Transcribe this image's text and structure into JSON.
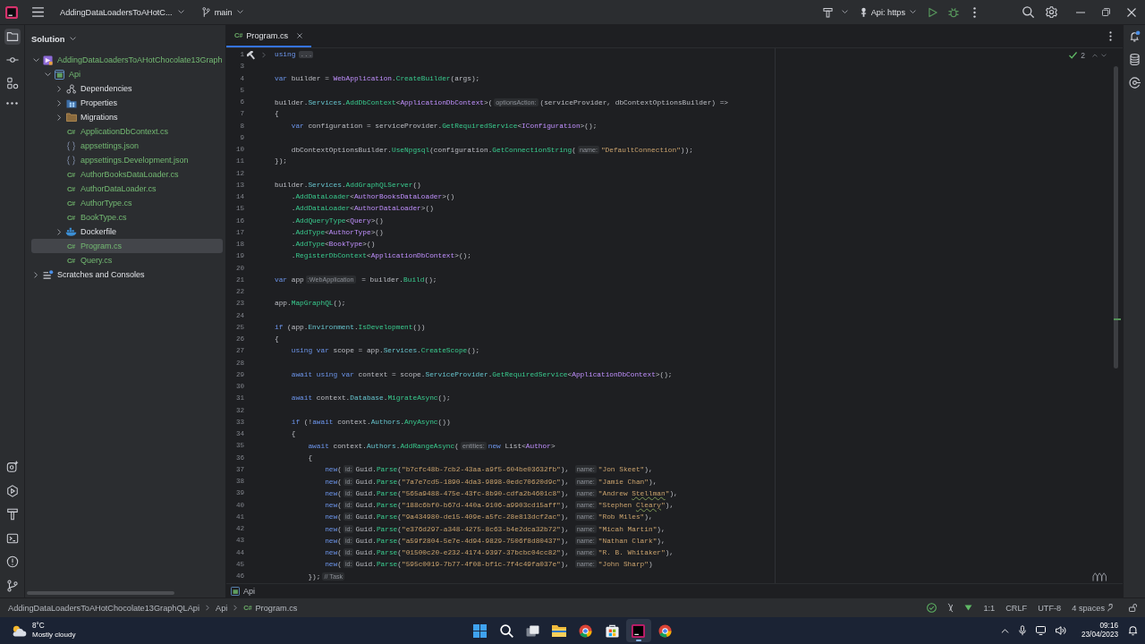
{
  "title_bar": {
    "project": "AddingDataLoadersToAHotC...",
    "branch": "main",
    "run_config": "Api: https"
  },
  "tool_strip": {
    "top": [
      {
        "kind": "project",
        "selected": true
      },
      {
        "kind": "commit",
        "selected": false
      },
      {
        "kind": "structure",
        "selected": false
      }
    ],
    "bottom": [
      {
        "kind": "services",
        "selected": false
      },
      {
        "kind": "run",
        "selected": false
      },
      {
        "kind": "build",
        "selected": false
      },
      {
        "kind": "terminal",
        "selected": false
      },
      {
        "kind": "problems",
        "selected": false
      },
      {
        "kind": "git",
        "selected": false
      }
    ]
  },
  "project_panel": {
    "title": "Solution",
    "tree": [
      {
        "label": "AddingDataLoadersToAHotChocolate13Graph",
        "kind": "solution",
        "vcs_added": true,
        "expanded": true,
        "selected": false,
        "children": [
          {
            "label": "Api",
            "kind": "project",
            "vcs_added": true,
            "expanded": true,
            "selected": false,
            "children": [
              {
                "label": "Dependencies",
                "kind": "dependencies",
                "vcs_added": false,
                "expanded": false,
                "selected": false
              },
              {
                "label": "Properties",
                "kind": "properties",
                "vcs_added": false,
                "expanded": false,
                "selected": false
              },
              {
                "label": "Migrations",
                "kind": "folder",
                "vcs_added": false,
                "expanded": false,
                "selected": false
              },
              {
                "label": "ApplicationDbContext.cs",
                "kind": "csharp",
                "icon_text": "C#",
                "vcs_added": true,
                "selected": false
              },
              {
                "label": "appsettings.json",
                "kind": "json",
                "vcs_added": true,
                "selected": false
              },
              {
                "label": "appsettings.Development.json",
                "kind": "json",
                "vcs_added": true,
                "selected": false
              },
              {
                "label": "AuthorBooksDataLoader.cs",
                "kind": "csharp",
                "icon_text": "C#",
                "vcs_added": true,
                "selected": false
              },
              {
                "label": "AuthorDataLoader.cs",
                "kind": "csharp",
                "icon_text": "C#",
                "vcs_added": true,
                "selected": false
              },
              {
                "label": "AuthorType.cs",
                "kind": "csharp",
                "icon_text": "C#",
                "vcs_added": true,
                "selected": false
              },
              {
                "label": "BookType.cs",
                "kind": "csharp",
                "icon_text": "C#",
                "vcs_added": true,
                "selected": false
              },
              {
                "label": "Dockerfile",
                "kind": "docker",
                "vcs_added": false,
                "expanded": false,
                "selected": false
              },
              {
                "label": "Program.cs",
                "kind": "csharp",
                "icon_text": "C#",
                "vcs_added": true,
                "selected": true
              },
              {
                "label": "Query.cs",
                "kind": "csharp",
                "icon_text": "C#",
                "vcs_added": true,
                "selected": false
              }
            ]
          }
        ]
      },
      {
        "label": "Scratches and Consoles",
        "kind": "scratches",
        "vcs_added": false,
        "expanded": false,
        "selected": false
      }
    ]
  },
  "editor": {
    "tabs": [
      {
        "label": "Program.cs",
        "icon_text": "C#",
        "selected": true
      }
    ],
    "inspection_count": "2",
    "lines": [
      {
        "number": "1",
        "runnable": true,
        "tokens": [
          {
            "kind": "keyword",
            "text": "using"
          },
          {
            "kind": "folded",
            "text": "..."
          }
        ]
      },
      {
        "number": "3"
      },
      {
        "number": "4",
        "tokens": [
          {
            "kind": "keyword",
            "text": "var"
          },
          {
            "kind": "plain",
            "text": " builder = "
          },
          {
            "kind": "type",
            "text": "WebApplication"
          },
          {
            "kind": "plain",
            "text": "."
          },
          {
            "kind": "method",
            "text": "CreateBuilder"
          },
          {
            "kind": "plain",
            "text": "(args);"
          }
        ]
      },
      {
        "number": "5"
      },
      {
        "number": "6",
        "tokens": [
          {
            "kind": "plain",
            "text": "builder."
          },
          {
            "kind": "member",
            "text": "Services"
          },
          {
            "kind": "plain",
            "text": "."
          },
          {
            "kind": "method",
            "text": "AddDbContext"
          },
          {
            "kind": "plain",
            "text": "<"
          },
          {
            "kind": "type",
            "text": "ApplicationDbContext"
          },
          {
            "kind": "plain",
            "text": ">("
          },
          {
            "kind": "hint",
            "text": "optionsAction:"
          },
          {
            "kind": "plain",
            "text": "(serviceProvider, dbContextOptionsBuilder) =>"
          }
        ]
      },
      {
        "number": "7",
        "tokens": [
          {
            "kind": "plain",
            "text": "{"
          }
        ]
      },
      {
        "number": "8",
        "tokens": [
          {
            "kind": "keyword",
            "text": "    var"
          },
          {
            "kind": "plain",
            "text": " configuration = serviceProvider."
          },
          {
            "kind": "method",
            "text": "GetRequiredService"
          },
          {
            "kind": "plain",
            "text": "<"
          },
          {
            "kind": "type",
            "text": "IConfiguration"
          },
          {
            "kind": "plain",
            "text": ">();"
          }
        ]
      },
      {
        "number": "9"
      },
      {
        "number": "10",
        "tokens": [
          {
            "kind": "plain",
            "text": "    dbContextOptionsBuilder."
          },
          {
            "kind": "method",
            "text": "UseNpgsql"
          },
          {
            "kind": "plain",
            "text": "(configuration."
          },
          {
            "kind": "method",
            "text": "GetConnectionString"
          },
          {
            "kind": "plain",
            "text": "("
          },
          {
            "kind": "hint",
            "text": "name:"
          },
          {
            "kind": "string",
            "text": "\"DefaultConnection\""
          },
          {
            "kind": "plain",
            "text": "));"
          }
        ]
      },
      {
        "number": "11",
        "tokens": [
          {
            "kind": "plain",
            "text": "});"
          }
        ]
      },
      {
        "number": "12"
      },
      {
        "number": "13",
        "tokens": [
          {
            "kind": "plain",
            "text": "builder."
          },
          {
            "kind": "member",
            "text": "Services"
          },
          {
            "kind": "plain",
            "text": "."
          },
          {
            "kind": "method",
            "text": "AddGraphQLServer"
          },
          {
            "kind": "plain",
            "text": "()"
          }
        ]
      },
      {
        "number": "14",
        "tokens": [
          {
            "kind": "plain",
            "text": "    ."
          },
          {
            "kind": "method",
            "text": "AddDataLoader"
          },
          {
            "kind": "plain",
            "text": "<"
          },
          {
            "kind": "type",
            "text": "AuthorBooksDataLoader"
          },
          {
            "kind": "plain",
            "text": ">()"
          }
        ]
      },
      {
        "number": "15",
        "tokens": [
          {
            "kind": "plain",
            "text": "    ."
          },
          {
            "kind": "method",
            "text": "AddDataLoader"
          },
          {
            "kind": "plain",
            "text": "<"
          },
          {
            "kind": "type",
            "text": "AuthorDataLoader"
          },
          {
            "kind": "plain",
            "text": ">()"
          }
        ]
      },
      {
        "number": "16",
        "tokens": [
          {
            "kind": "plain",
            "text": "    ."
          },
          {
            "kind": "method",
            "text": "AddQueryType"
          },
          {
            "kind": "plain",
            "text": "<"
          },
          {
            "kind": "type",
            "text": "Query"
          },
          {
            "kind": "plain",
            "text": ">()"
          }
        ]
      },
      {
        "number": "17",
        "tokens": [
          {
            "kind": "plain",
            "text": "    ."
          },
          {
            "kind": "method",
            "text": "AddType"
          },
          {
            "kind": "plain",
            "text": "<"
          },
          {
            "kind": "type",
            "text": "AuthorType"
          },
          {
            "kind": "plain",
            "text": ">()"
          }
        ]
      },
      {
        "number": "18",
        "tokens": [
          {
            "kind": "plain",
            "text": "    ."
          },
          {
            "kind": "method",
            "text": "AddType"
          },
          {
            "kind": "plain",
            "text": "<"
          },
          {
            "kind": "type",
            "text": "BookType"
          },
          {
            "kind": "plain",
            "text": ">()"
          }
        ]
      },
      {
        "number": "19",
        "tokens": [
          {
            "kind": "plain",
            "text": "    ."
          },
          {
            "kind": "method",
            "text": "RegisterDbContext"
          },
          {
            "kind": "plain",
            "text": "<"
          },
          {
            "kind": "type",
            "text": "ApplicationDbContext"
          },
          {
            "kind": "plain",
            "text": ">();"
          }
        ]
      },
      {
        "number": "20"
      },
      {
        "number": "21",
        "tokens": [
          {
            "kind": "keyword",
            "text": "var"
          },
          {
            "kind": "plain",
            "text": " app"
          },
          {
            "kind": "hint",
            "text": ":WebApplication"
          },
          {
            "kind": "plain",
            "text": " = builder."
          },
          {
            "kind": "method",
            "text": "Build"
          },
          {
            "kind": "plain",
            "text": "();"
          }
        ]
      },
      {
        "number": "22"
      },
      {
        "number": "23",
        "tokens": [
          {
            "kind": "plain",
            "text": "app."
          },
          {
            "kind": "method",
            "text": "MapGraphQL"
          },
          {
            "kind": "plain",
            "text": "();"
          }
        ]
      },
      {
        "number": "24"
      },
      {
        "number": "25",
        "tokens": [
          {
            "kind": "keyword",
            "text": "if"
          },
          {
            "kind": "plain",
            "text": " (app."
          },
          {
            "kind": "member",
            "text": "Environment"
          },
          {
            "kind": "plain",
            "text": "."
          },
          {
            "kind": "method",
            "text": "IsDevelopment"
          },
          {
            "kind": "plain",
            "text": "())"
          }
        ]
      },
      {
        "number": "26",
        "tokens": [
          {
            "kind": "plain",
            "text": "{"
          }
        ]
      },
      {
        "number": "27",
        "tokens": [
          {
            "kind": "keyword",
            "text": "    using var"
          },
          {
            "kind": "plain",
            "text": " scope = app."
          },
          {
            "kind": "member",
            "text": "Services"
          },
          {
            "kind": "plain",
            "text": "."
          },
          {
            "kind": "method",
            "text": "CreateScope"
          },
          {
            "kind": "plain",
            "text": "();"
          }
        ]
      },
      {
        "number": "28"
      },
      {
        "number": "29",
        "tokens": [
          {
            "kind": "keyword",
            "text": "    await using var"
          },
          {
            "kind": "plain",
            "text": " context = scope."
          },
          {
            "kind": "member",
            "text": "ServiceProvider"
          },
          {
            "kind": "plain",
            "text": "."
          },
          {
            "kind": "method",
            "text": "GetRequiredService"
          },
          {
            "kind": "plain",
            "text": "<"
          },
          {
            "kind": "type",
            "text": "ApplicationDbContext"
          },
          {
            "kind": "plain",
            "text": ">();"
          }
        ]
      },
      {
        "number": "30"
      },
      {
        "number": "31",
        "tokens": [
          {
            "kind": "keyword",
            "text": "    await"
          },
          {
            "kind": "plain",
            "text": " context."
          },
          {
            "kind": "member",
            "text": "Database"
          },
          {
            "kind": "plain",
            "text": "."
          },
          {
            "kind": "method",
            "text": "MigrateAsync"
          },
          {
            "kind": "plain",
            "text": "();"
          }
        ]
      },
      {
        "number": "32"
      },
      {
        "number": "33",
        "tokens": [
          {
            "kind": "keyword",
            "text": "    if"
          },
          {
            "kind": "plain",
            "text": " (!"
          },
          {
            "kind": "keyword",
            "text": "await"
          },
          {
            "kind": "plain",
            "text": " context."
          },
          {
            "kind": "member",
            "text": "Authors"
          },
          {
            "kind": "plain",
            "text": "."
          },
          {
            "kind": "method",
            "text": "AnyAsync"
          },
          {
            "kind": "plain",
            "text": "())"
          }
        ]
      },
      {
        "number": "34",
        "tokens": [
          {
            "kind": "plain",
            "text": "    {"
          }
        ]
      },
      {
        "number": "35",
        "tokens": [
          {
            "kind": "keyword",
            "text": "        await"
          },
          {
            "kind": "plain",
            "text": " context."
          },
          {
            "kind": "member",
            "text": "Authors"
          },
          {
            "kind": "plain",
            "text": "."
          },
          {
            "kind": "method",
            "text": "AddRangeAsync"
          },
          {
            "kind": "plain",
            "text": "("
          },
          {
            "kind": "hint",
            "text": "entities:"
          },
          {
            "kind": "keyword",
            "text": "new"
          },
          {
            "kind": "plain",
            "text": " List<"
          },
          {
            "kind": "type",
            "text": "Author"
          },
          {
            "kind": "plain",
            "text": ">"
          }
        ]
      },
      {
        "number": "36",
        "tokens": [
          {
            "kind": "plain",
            "text": "        {"
          }
        ]
      },
      {
        "number": "37",
        "tokens": [
          {
            "kind": "keyword",
            "text": "            new"
          },
          {
            "kind": "plain",
            "text": "("
          },
          {
            "kind": "hint",
            "text": "id:"
          },
          {
            "kind": "plain",
            "text": "Guid."
          },
          {
            "kind": "method",
            "text": "Parse"
          },
          {
            "kind": "plain",
            "text": "("
          },
          {
            "kind": "string",
            "text": "\"b7cfc48b-7cb2-43aa-a9f5-604be03632fb\""
          },
          {
            "kind": "plain",
            "text": "), "
          },
          {
            "kind": "hint",
            "text": "name:"
          },
          {
            "kind": "string",
            "text": "\"Jon Skeet\""
          },
          {
            "kind": "plain",
            "text": "),"
          }
        ]
      },
      {
        "number": "38",
        "tokens": [
          {
            "kind": "keyword",
            "text": "            new"
          },
          {
            "kind": "plain",
            "text": "("
          },
          {
            "kind": "hint",
            "text": "id:"
          },
          {
            "kind": "plain",
            "text": "Guid."
          },
          {
            "kind": "method",
            "text": "Parse"
          },
          {
            "kind": "plain",
            "text": "("
          },
          {
            "kind": "string",
            "text": "\"7a7e7cd5-1890-4da3-9898-0edc70620d9c\""
          },
          {
            "kind": "plain",
            "text": "), "
          },
          {
            "kind": "hint",
            "text": "name:"
          },
          {
            "kind": "string",
            "text": "\"Jamie Chan\""
          },
          {
            "kind": "plain",
            "text": "),"
          }
        ]
      },
      {
        "number": "39",
        "tokens": [
          {
            "kind": "keyword",
            "text": "            new"
          },
          {
            "kind": "plain",
            "text": "("
          },
          {
            "kind": "hint",
            "text": "id:"
          },
          {
            "kind": "plain",
            "text": "Guid."
          },
          {
            "kind": "method",
            "text": "Parse"
          },
          {
            "kind": "plain",
            "text": "("
          },
          {
            "kind": "string",
            "text": "\"565a9488-475e-43fc-8b90-cdfa2b4601c8\""
          },
          {
            "kind": "plain",
            "text": "), "
          },
          {
            "kind": "hint",
            "text": "name:"
          },
          {
            "kind": "string",
            "text": "\"Andrew "
          },
          {
            "kind": "typo",
            "text": "Stellman"
          },
          {
            "kind": "string",
            "text": "\""
          },
          {
            "kind": "plain",
            "text": "),"
          }
        ]
      },
      {
        "number": "40",
        "tokens": [
          {
            "kind": "keyword",
            "text": "            new"
          },
          {
            "kind": "plain",
            "text": "("
          },
          {
            "kind": "hint",
            "text": "id:"
          },
          {
            "kind": "plain",
            "text": "Guid."
          },
          {
            "kind": "method",
            "text": "Parse"
          },
          {
            "kind": "plain",
            "text": "("
          },
          {
            "kind": "string",
            "text": "\"188c6bf0-b67d-440a-9106-a9903cd15aff\""
          },
          {
            "kind": "plain",
            "text": "), "
          },
          {
            "kind": "hint",
            "text": "name:"
          },
          {
            "kind": "string",
            "text": "\"Stephen "
          },
          {
            "kind": "typo",
            "text": "Cleary"
          },
          {
            "kind": "string",
            "text": "\""
          },
          {
            "kind": "plain",
            "text": "),"
          }
        ]
      },
      {
        "number": "41",
        "tokens": [
          {
            "kind": "keyword",
            "text": "            new"
          },
          {
            "kind": "plain",
            "text": "("
          },
          {
            "kind": "hint",
            "text": "id:"
          },
          {
            "kind": "plain",
            "text": "Guid."
          },
          {
            "kind": "method",
            "text": "Parse"
          },
          {
            "kind": "plain",
            "text": "("
          },
          {
            "kind": "string",
            "text": "\"9a434980-de15-409e-a5fc-28e813dcf2ac\""
          },
          {
            "kind": "plain",
            "text": "), "
          },
          {
            "kind": "hint",
            "text": "name:"
          },
          {
            "kind": "string",
            "text": "\"Rob Miles\""
          },
          {
            "kind": "plain",
            "text": "),"
          }
        ]
      },
      {
        "number": "42",
        "tokens": [
          {
            "kind": "keyword",
            "text": "            new"
          },
          {
            "kind": "plain",
            "text": "("
          },
          {
            "kind": "hint",
            "text": "id:"
          },
          {
            "kind": "plain",
            "text": "Guid."
          },
          {
            "kind": "method",
            "text": "Parse"
          },
          {
            "kind": "plain",
            "text": "("
          },
          {
            "kind": "string",
            "text": "\"e376d297-a348-4275-8c63-b4e2dca32b72\""
          },
          {
            "kind": "plain",
            "text": "), "
          },
          {
            "kind": "hint",
            "text": "name:"
          },
          {
            "kind": "string",
            "text": "\"Micah Martin\""
          },
          {
            "kind": "plain",
            "text": "),"
          }
        ]
      },
      {
        "number": "43",
        "tokens": [
          {
            "kind": "keyword",
            "text": "            new"
          },
          {
            "kind": "plain",
            "text": "("
          },
          {
            "kind": "hint",
            "text": "id:"
          },
          {
            "kind": "plain",
            "text": "Guid."
          },
          {
            "kind": "method",
            "text": "Parse"
          },
          {
            "kind": "plain",
            "text": "("
          },
          {
            "kind": "string",
            "text": "\"a59f2804-5e7e-4d94-9829-7506f8d80437\""
          },
          {
            "kind": "plain",
            "text": "), "
          },
          {
            "kind": "hint",
            "text": "name:"
          },
          {
            "kind": "string",
            "text": "\"Nathan Clark\""
          },
          {
            "kind": "plain",
            "text": "),"
          }
        ]
      },
      {
        "number": "44",
        "tokens": [
          {
            "kind": "keyword",
            "text": "            new"
          },
          {
            "kind": "plain",
            "text": "("
          },
          {
            "kind": "hint",
            "text": "id:"
          },
          {
            "kind": "plain",
            "text": "Guid."
          },
          {
            "kind": "method",
            "text": "Parse"
          },
          {
            "kind": "plain",
            "text": "("
          },
          {
            "kind": "string",
            "text": "\"01500c20-e232-4174-9397-37bcbc04cc82\""
          },
          {
            "kind": "plain",
            "text": "), "
          },
          {
            "kind": "hint",
            "text": "name:"
          },
          {
            "kind": "string",
            "text": "\"R. B. Whitaker\""
          },
          {
            "kind": "plain",
            "text": "),"
          }
        ]
      },
      {
        "number": "45",
        "tokens": [
          {
            "kind": "keyword",
            "text": "            new"
          },
          {
            "kind": "plain",
            "text": "("
          },
          {
            "kind": "hint",
            "text": "id:"
          },
          {
            "kind": "plain",
            "text": "Guid."
          },
          {
            "kind": "method",
            "text": "Parse"
          },
          {
            "kind": "plain",
            "text": "("
          },
          {
            "kind": "string",
            "text": "\"595c0019-7b77-4f08-bf1c-7f4c49fa037e\""
          },
          {
            "kind": "plain",
            "text": "), "
          },
          {
            "kind": "hint",
            "text": "name:"
          },
          {
            "kind": "string",
            "text": "\"John Sharp\""
          },
          {
            "kind": "plain",
            "text": ")"
          }
        ]
      },
      {
        "number": "46",
        "tokens": [
          {
            "kind": "plain",
            "text": "        });"
          },
          {
            "kind": "hint",
            "text": "// Task"
          }
        ]
      }
    ],
    "breadcrumb": "Api"
  },
  "status_bar": {
    "path": [
      {
        "label": "AddingDataLoadersToAHotChocolate13GraphQLApi"
      },
      {
        "label": "Api"
      },
      {
        "label": "Program.cs",
        "icon_text": "C#"
      }
    ],
    "position": "1:1",
    "line_ending": "CRLF",
    "encoding": "UTF-8",
    "indent": "4 spaces"
  },
  "taskbar": {
    "weather": {
      "temperature": "8°C",
      "condition": "Mostly cloudy"
    },
    "apps": [
      {
        "kind": "start",
        "selected": false
      },
      {
        "kind": "search",
        "selected": false
      },
      {
        "kind": "taskview",
        "selected": false
      },
      {
        "kind": "files",
        "selected": false
      },
      {
        "kind": "browser",
        "selected": false
      },
      {
        "kind": "store",
        "selected": false
      },
      {
        "kind": "ide",
        "selected": true
      },
      {
        "kind": "browser",
        "selected": false
      }
    ],
    "time": "09:16",
    "date": "23/04/2023"
  }
}
